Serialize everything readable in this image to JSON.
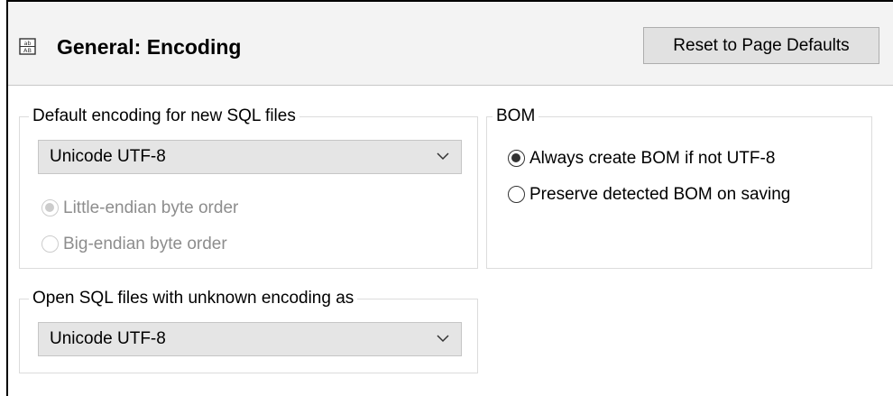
{
  "header": {
    "title": "General: Encoding",
    "icon": "encoding-page-icon",
    "reset_label": "Reset to Page Defaults"
  },
  "default_encoding": {
    "legend": "Default encoding for new SQL files",
    "selected": "Unicode UTF-8",
    "byte_order_options": [
      {
        "label": "Little-endian byte order",
        "checked": true,
        "enabled": false
      },
      {
        "label": "Big-endian byte order",
        "checked": false,
        "enabled": false
      }
    ]
  },
  "bom": {
    "legend": "BOM",
    "options": [
      {
        "label": "Always create BOM if not UTF-8",
        "checked": true
      },
      {
        "label": "Preserve detected BOM on saving",
        "checked": false
      }
    ]
  },
  "unknown_encoding": {
    "legend": "Open SQL files with unknown encoding as",
    "selected": "Unicode UTF-8"
  },
  "colors": {
    "header_bg": "#f3f3f3",
    "select_bg": "#e5e5e5",
    "disabled_text": "#8d8d8d"
  }
}
